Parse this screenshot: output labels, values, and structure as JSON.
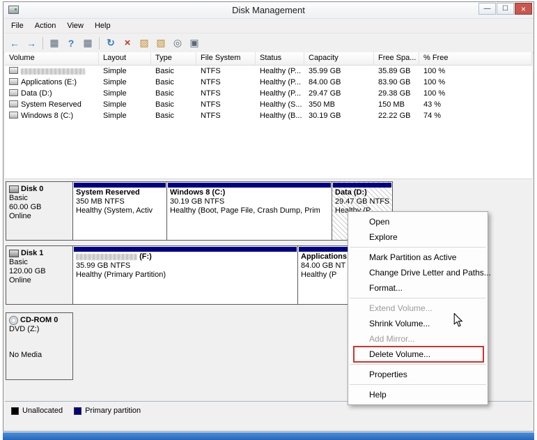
{
  "window": {
    "title": "Disk Management",
    "controls": {
      "minimize": "—",
      "maximize": "☐",
      "close": "×"
    }
  },
  "menubar": {
    "items": [
      "File",
      "Action",
      "View",
      "Help"
    ]
  },
  "toolbar": {
    "icons": [
      {
        "name": "back",
        "glyph": "←"
      },
      {
        "name": "forward",
        "glyph": "→"
      },
      {
        "name": "console-tree",
        "glyph": "▦"
      },
      {
        "name": "help",
        "glyph": "?"
      },
      {
        "name": "console-window",
        "glyph": "▦"
      },
      {
        "name": "refresh",
        "glyph": "↻"
      },
      {
        "name": "delete",
        "glyph": "×"
      },
      {
        "name": "folder-open",
        "glyph": "▨"
      },
      {
        "name": "properties",
        "glyph": "▨"
      },
      {
        "name": "search",
        "glyph": "◎"
      },
      {
        "name": "disk-tool",
        "glyph": "▣"
      }
    ]
  },
  "volume_table": {
    "columns": [
      "Volume",
      "Layout",
      "Type",
      "File System",
      "Status",
      "Capacity",
      "Free Spa...",
      "% Free"
    ],
    "rows": [
      {
        "volume": "",
        "layout": "Simple",
        "type": "Basic",
        "file_system": "NTFS",
        "status": "Healthy (P...",
        "capacity": "35.99 GB",
        "free_space": "35.89 GB",
        "percent_free": "100 %"
      },
      {
        "volume": "Applications (E:)",
        "layout": "Simple",
        "type": "Basic",
        "file_system": "NTFS",
        "status": "Healthy (P...",
        "capacity": "84.00 GB",
        "free_space": "83.90 GB",
        "percent_free": "100 %"
      },
      {
        "volume": "Data (D:)",
        "layout": "Simple",
        "type": "Basic",
        "file_system": "NTFS",
        "status": "Healthy (P...",
        "capacity": "29.47 GB",
        "free_space": "29.38 GB",
        "percent_free": "100 %"
      },
      {
        "volume": "System Reserved",
        "layout": "Simple",
        "type": "Basic",
        "file_system": "NTFS",
        "status": "Healthy (S...",
        "capacity": "350 MB",
        "free_space": "150 MB",
        "percent_free": "43 %"
      },
      {
        "volume": "Windows 8 (C:)",
        "layout": "Simple",
        "type": "Basic",
        "file_system": "NTFS",
        "status": "Healthy (B...",
        "capacity": "30.19 GB",
        "free_space": "22.22 GB",
        "percent_free": "74 %"
      }
    ]
  },
  "disks": [
    {
      "name": "Disk 0",
      "type": "Basic",
      "size": "60.00 GB",
      "status": "Online",
      "partitions": [
        {
          "name": "System Reserved",
          "size": "350 MB NTFS",
          "status": "Healthy (System, Activ"
        },
        {
          "name": "Windows 8  (C:)",
          "size": "30.19 GB NTFS",
          "status": "Healthy (Boot, Page File, Crash Dump, Prim"
        },
        {
          "name": "Data  (D:)",
          "size": "29.47 GB NTFS",
          "status": "Healthy (P"
        }
      ]
    },
    {
      "name": "Disk 1",
      "type": "Basic",
      "size": "120.00 GB",
      "status": "Online",
      "partitions": [
        {
          "name": "(F:)",
          "size": "35.99 GB NTFS",
          "status": "Healthy (Primary Partition)"
        },
        {
          "name": "Applications",
          "size": "84.00 GB NT",
          "status": "Healthy (P"
        }
      ]
    }
  ],
  "cdrom": {
    "name": "CD-ROM 0",
    "drive": "DVD (Z:)",
    "media": "No Media"
  },
  "context_menu": {
    "group1": [
      "Open",
      "Explore"
    ],
    "group2": [
      "Mark Partition as Active",
      "Change Drive Letter and Paths...",
      "Format..."
    ],
    "group3": [
      "Extend Volume...",
      "Shrink Volume...",
      "Add Mirror...",
      "Delete Volume..."
    ],
    "group4": [
      "Properties"
    ],
    "group5": [
      "Help"
    ]
  },
  "legend": {
    "unallocated": "Unallocated",
    "primary": "Primary partition"
  },
  "colors": {
    "partition_bar": "#000082",
    "legend_unallocated": "#000000",
    "legend_primary": "#000082",
    "annotation_red": "#d0342a",
    "bottom_strip_blue": "#2e74cf"
  }
}
